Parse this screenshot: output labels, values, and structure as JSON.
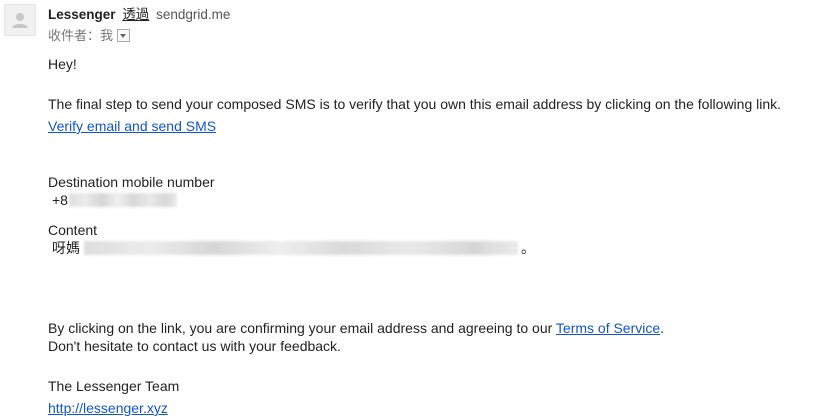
{
  "header": {
    "sender_name": "Lessenger",
    "via_label": "透過",
    "via_domain": "sendgrid.me",
    "recipient_prefix": "收件者：",
    "recipient_name": "我"
  },
  "body": {
    "greeting": "Hey!",
    "intro": "The final step to send your composed SMS is to verify that you own this email address by clicking on the following link.",
    "verify_link": "Verify email and send SMS",
    "destination_label": "Destination mobile number",
    "destination_value_visible": "+8",
    "content_label": "Content",
    "content_value_visible_start": "呀媽",
    "content_value_visible_end": "。",
    "consent_prefix": "By clicking on the link, you are confirming your email address and agreeing to our ",
    "terms_link": "Terms of Service",
    "consent_suffix": ".",
    "feedback": "Don't hesitate to contact us with your feedback.",
    "team": "The Lessenger Team",
    "site_link": "http://lessenger.xyz"
  },
  "colors": {
    "link": "#1155cc",
    "text": "#222222",
    "muted": "#777777"
  }
}
